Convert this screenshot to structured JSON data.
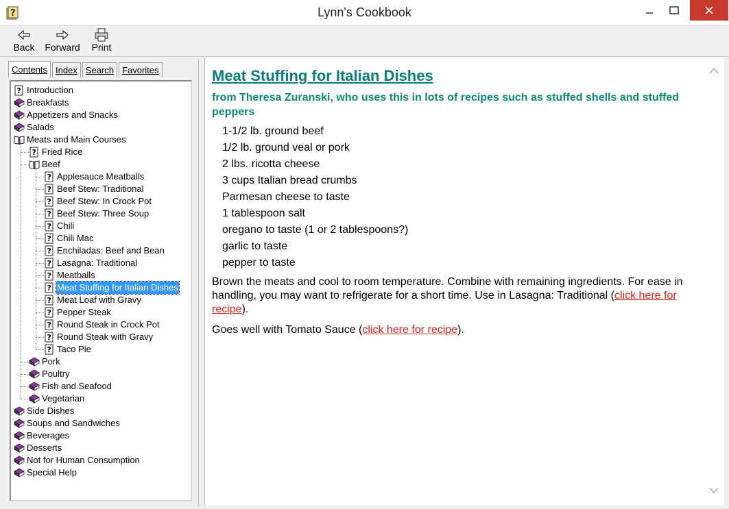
{
  "window": {
    "title": "Lynn's Cookbook",
    "icon": "help-book-icon"
  },
  "toolbar": {
    "back_label": "Back",
    "forward_label": "Forward",
    "print_label": "Print"
  },
  "tabs": [
    {
      "label": "Contents",
      "active": true
    },
    {
      "label": "Index",
      "active": false
    },
    {
      "label": "Search",
      "active": false
    },
    {
      "label": "Favorites",
      "active": false
    }
  ],
  "tree": [
    {
      "label": "Introduction",
      "type": "topic",
      "level": 0
    },
    {
      "label": "Breakfasts",
      "type": "book",
      "level": 0
    },
    {
      "label": "Appetizers and Snacks",
      "type": "book",
      "level": 0
    },
    {
      "label": "Salads",
      "type": "book",
      "level": 0
    },
    {
      "label": "Meats and Main Courses",
      "type": "open-book",
      "level": 0
    },
    {
      "label": "Fried Rice",
      "type": "topic",
      "level": 1
    },
    {
      "label": "Beef",
      "type": "open-book",
      "level": 1
    },
    {
      "label": "Applesauce Meatballs",
      "type": "topic",
      "level": 2
    },
    {
      "label": "Beef Stew: Traditional",
      "type": "topic",
      "level": 2
    },
    {
      "label": "Beef Stew: In Crock Pot",
      "type": "topic",
      "level": 2
    },
    {
      "label": "Beef Stew: Three Soup",
      "type": "topic",
      "level": 2
    },
    {
      "label": "Chili",
      "type": "topic",
      "level": 2
    },
    {
      "label": "Chili Mac",
      "type": "topic",
      "level": 2
    },
    {
      "label": "Enchiladas: Beef and Bean",
      "type": "topic",
      "level": 2
    },
    {
      "label": "Lasagna: Traditional",
      "type": "topic",
      "level": 2
    },
    {
      "label": "Meatballs",
      "type": "topic",
      "level": 2
    },
    {
      "label": "Meat Stuffing for Italian Dishes",
      "type": "topic",
      "level": 2,
      "selected": true
    },
    {
      "label": "Meat Loaf with Gravy",
      "type": "topic",
      "level": 2
    },
    {
      "label": "Pepper Steak",
      "type": "topic",
      "level": 2
    },
    {
      "label": "Round Steak in Crock Pot",
      "type": "topic",
      "level": 2
    },
    {
      "label": "Round Steak with Gravy",
      "type": "topic",
      "level": 2
    },
    {
      "label": "Taco Pie",
      "type": "topic",
      "level": 2
    },
    {
      "label": "Pork",
      "type": "book",
      "level": 1
    },
    {
      "label": "Poultry",
      "type": "book",
      "level": 1
    },
    {
      "label": "Fish and Seafood",
      "type": "book",
      "level": 1
    },
    {
      "label": "Vegetarian",
      "type": "book",
      "level": 1
    },
    {
      "label": "Side Dishes",
      "type": "book",
      "level": 0
    },
    {
      "label": "Soups and Sandwiches",
      "type": "book",
      "level": 0
    },
    {
      "label": "Beverages",
      "type": "book",
      "level": 0
    },
    {
      "label": "Desserts",
      "type": "book",
      "level": 0
    },
    {
      "label": "Not for Human Consumption",
      "type": "book",
      "level": 0
    },
    {
      "label": "Special Help",
      "type": "book",
      "level": 0
    }
  ],
  "article": {
    "title": "Meat Stuffing for Italian Dishes",
    "subtitle": "from Theresa Zuranski, who uses this in lots of recipes such as stuffed shells and stuffed peppers",
    "ingredients": [
      "1-1/2 lb. ground beef",
      "1/2 lb. ground veal or pork",
      "2 lbs. ricotta cheese",
      "3 cups Italian bread crumbs",
      "Parmesan cheese to taste",
      "1 tablespoon salt",
      "oregano to taste (1 or 2 tablespoons?)",
      "garlic to taste",
      "pepper to taste"
    ],
    "para1_text": "Brown the meats and cool to room temperature. Combine with remaining ingredients. For ease in handling, you may want to refrigerate for a short time. Use in Lasagna: Traditional (",
    "para1_link": "click here for recipe",
    "para1_end": ").",
    "para2_text": "Goes well with Tomato Sauce (",
    "para2_link": "click here for recipe",
    "para2_end": ").",
    "colors": {
      "heading": "#0b7b7b",
      "link": "#e0201a",
      "selection": "#3399ff"
    }
  }
}
